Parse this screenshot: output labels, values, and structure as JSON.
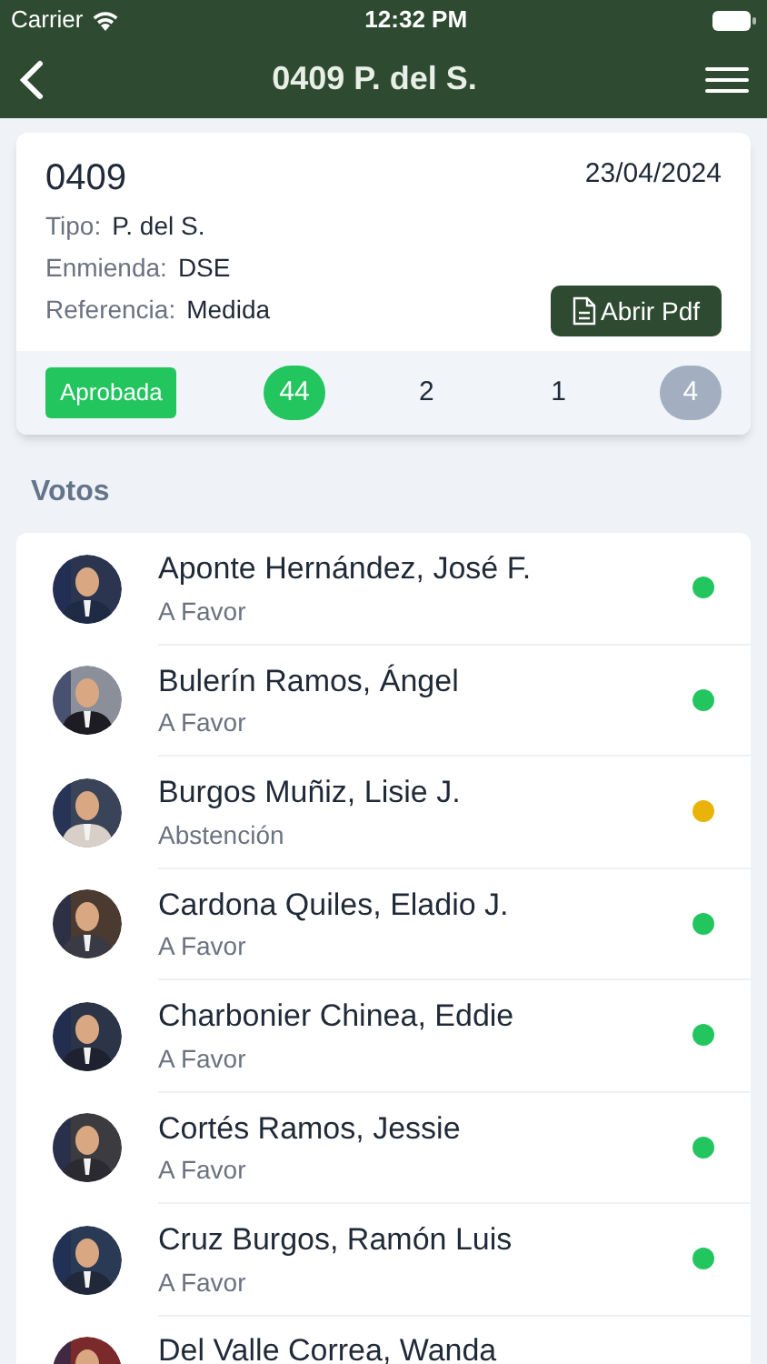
{
  "status_bar": {
    "carrier": "Carrier",
    "time": "12:32 PM"
  },
  "header": {
    "title": "0409 P. del S."
  },
  "card": {
    "number": "0409",
    "date": "23/04/2024",
    "fields": [
      {
        "label": "Tipo:",
        "value": "P. del S."
      },
      {
        "label": "Enmienda:",
        "value": "DSE"
      },
      {
        "label": "Referencia:",
        "value": "Medida"
      }
    ],
    "pdf_button": "Abrir Pdf",
    "result": "Aprobada",
    "counts": [
      {
        "value": "44",
        "kind": "filled"
      },
      {
        "value": "2",
        "kind": "plain"
      },
      {
        "value": "1",
        "kind": "plain"
      },
      {
        "value": "4",
        "kind": "muted"
      }
    ]
  },
  "votes_heading": "Votos",
  "votes": [
    {
      "name": "Aponte Hernández, José F.",
      "vote": "A Favor",
      "color": "#22c55e"
    },
    {
      "name": "Bulerín Ramos, Ángel",
      "vote": "A Favor",
      "color": "#22c55e"
    },
    {
      "name": "Burgos Muñiz, Lisie J.",
      "vote": "Abstención",
      "color": "#eab308"
    },
    {
      "name": "Cardona Quiles, Eladio J.",
      "vote": "A Favor",
      "color": "#22c55e"
    },
    {
      "name": "Charbonier Chinea, Eddie",
      "vote": "A Favor",
      "color": "#22c55e"
    },
    {
      "name": "Cortés Ramos, Jessie",
      "vote": "A Favor",
      "color": "#22c55e"
    },
    {
      "name": "Cruz Burgos, Ramón Luis",
      "vote": "A Favor",
      "color": "#22c55e"
    },
    {
      "name": "Del Valle Correa, Wanda"
    }
  ]
}
